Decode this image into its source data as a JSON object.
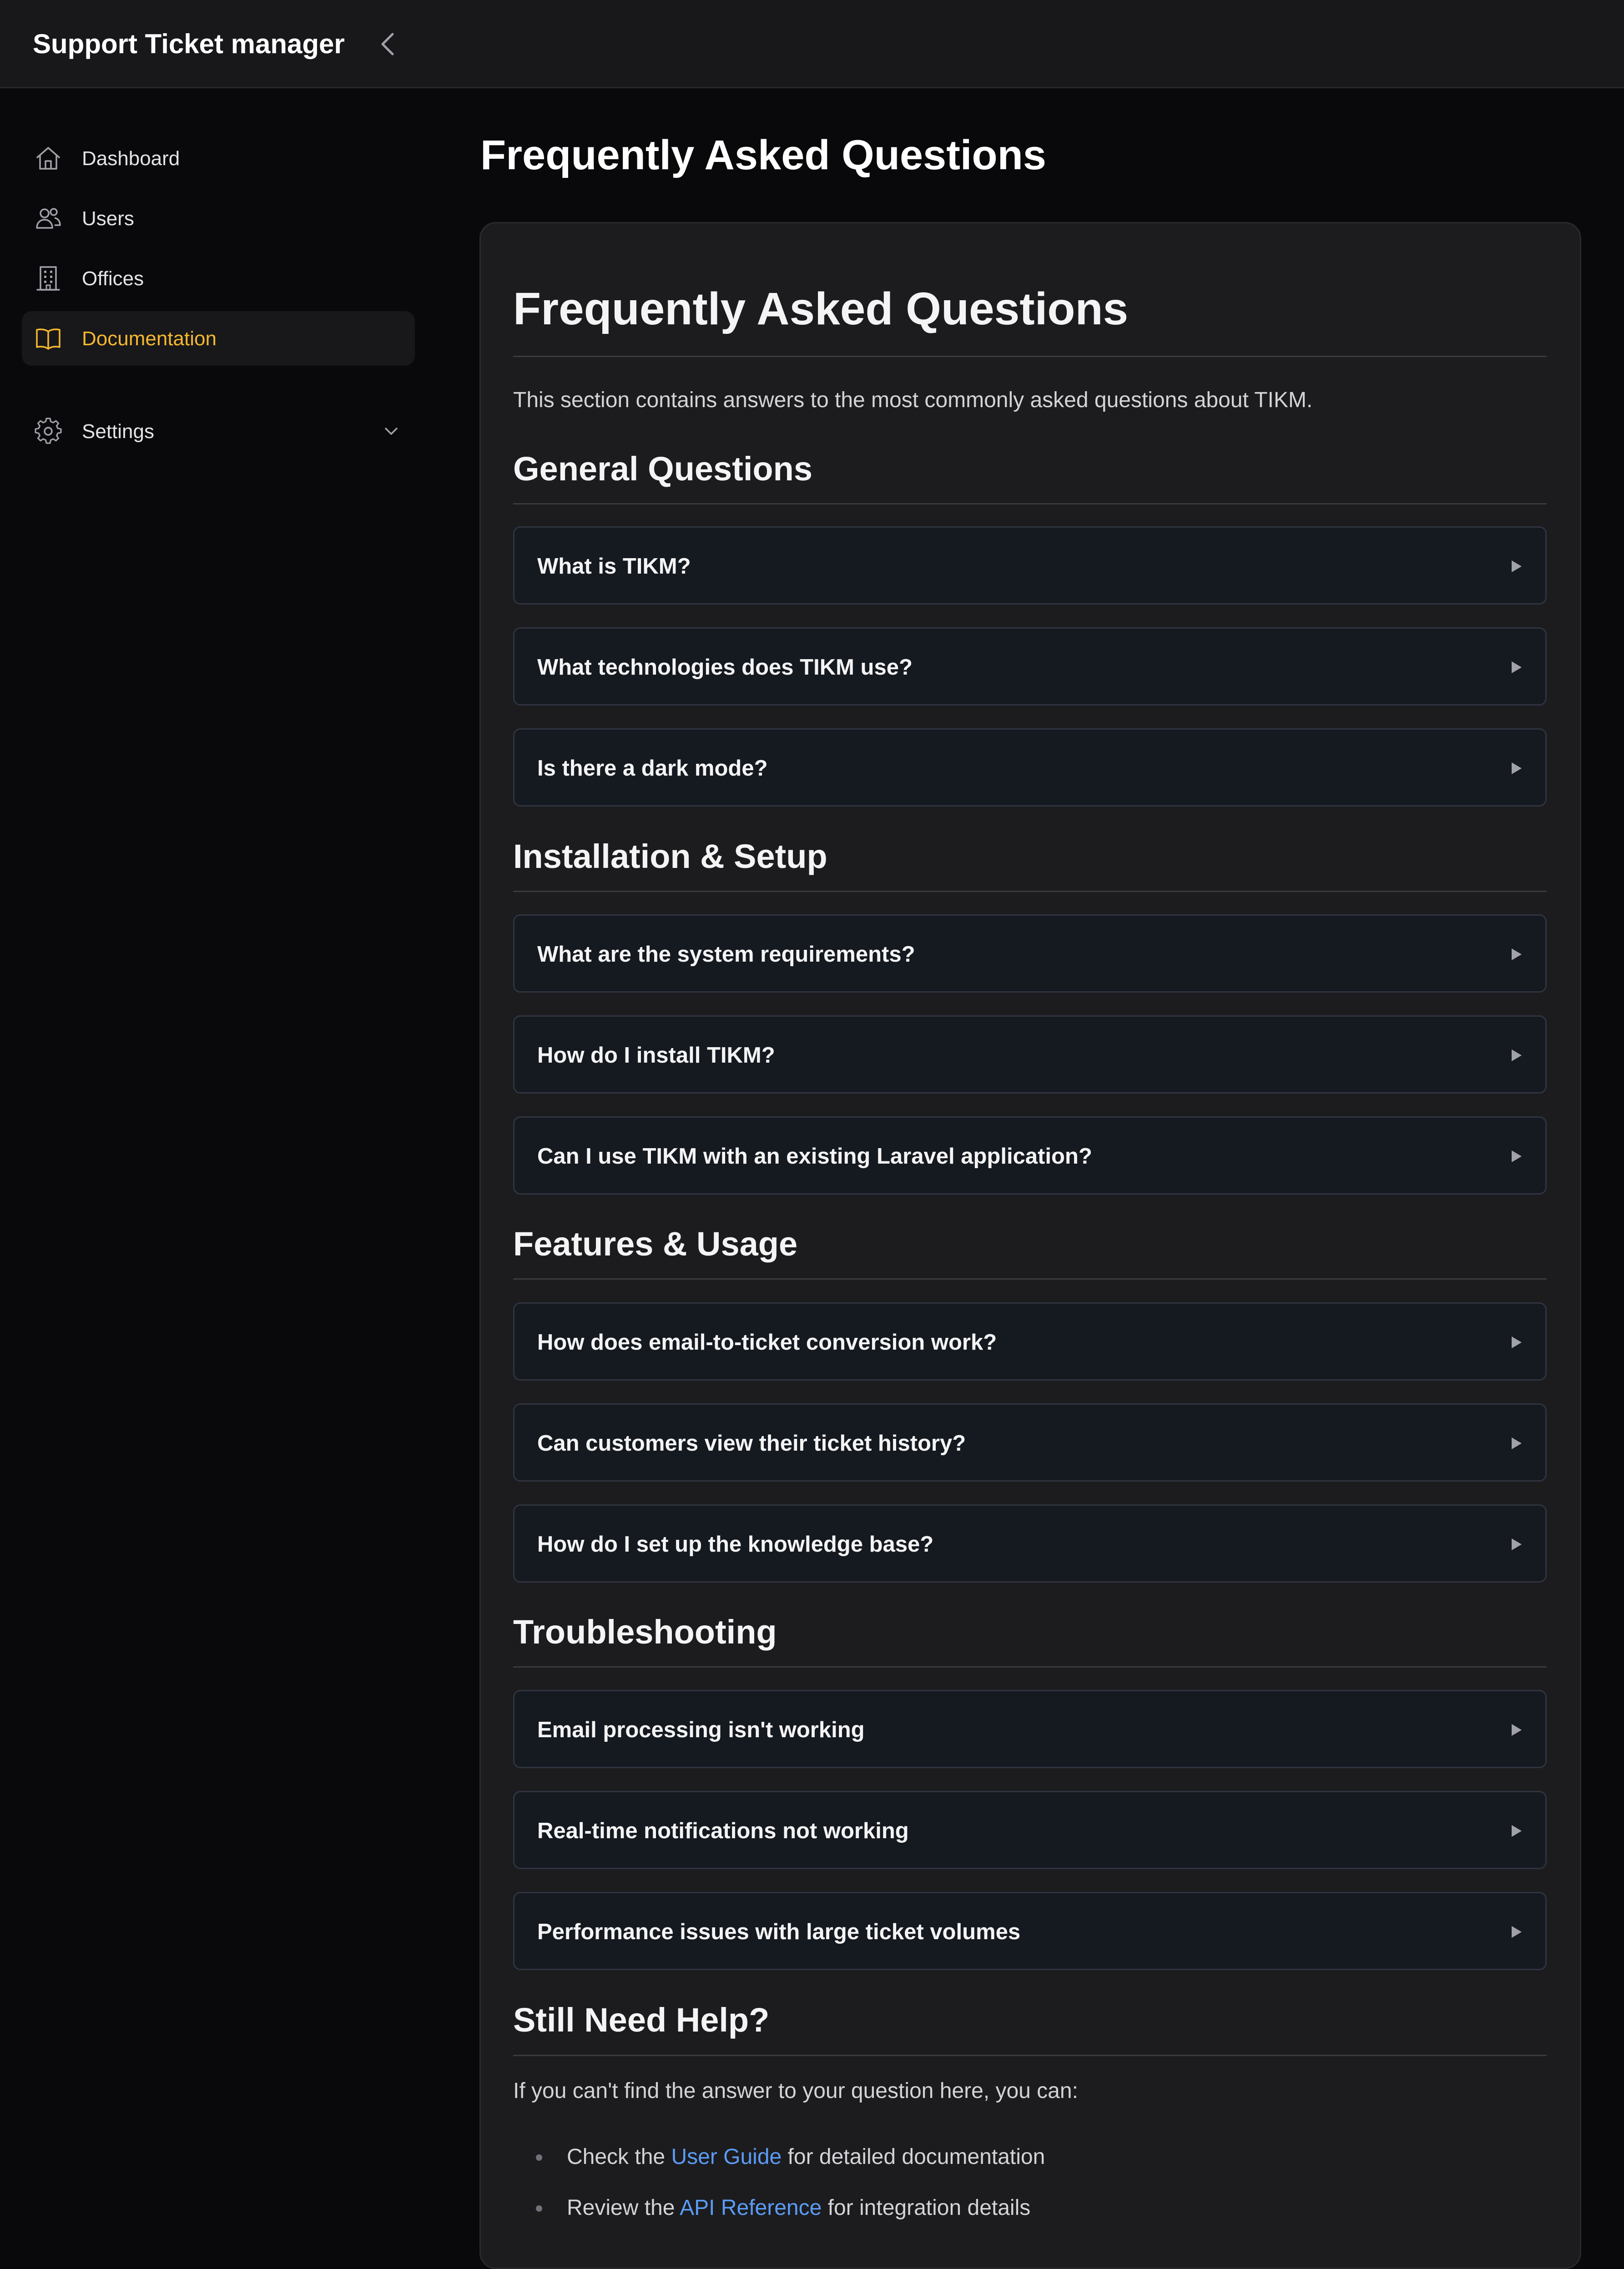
{
  "app": {
    "title": "Support Ticket manager"
  },
  "sidebar": {
    "items": [
      {
        "label": "Dashboard",
        "icon": "home-icon"
      },
      {
        "label": "Users",
        "icon": "users-icon"
      },
      {
        "label": "Offices",
        "icon": "building-icon"
      },
      {
        "label": "Documentation",
        "icon": "book-open-icon",
        "active": true
      },
      {
        "label": "Settings",
        "icon": "gear-icon",
        "expandable": true
      }
    ]
  },
  "page": {
    "title": "Frequently Asked Questions"
  },
  "content": {
    "heading": "Frequently Asked Questions",
    "intro": "This section contains answers to the most commonly asked questions about TIKM.",
    "sections": [
      {
        "title": "General Questions",
        "questions": [
          "What is TIKM?",
          "What technologies does TIKM use?",
          "Is there a dark mode?"
        ]
      },
      {
        "title": "Installation & Setup",
        "questions": [
          "What are the system requirements?",
          "How do I install TIKM?",
          "Can I use TIKM with an existing Laravel application?"
        ]
      },
      {
        "title": "Features & Usage",
        "questions": [
          "How does email-to-ticket conversion work?",
          "Can customers view their ticket history?",
          "How do I set up the knowledge base?"
        ]
      },
      {
        "title": "Troubleshooting",
        "questions": [
          "Email processing isn't working",
          "Real-time notifications not working",
          "Performance issues with large ticket volumes"
        ]
      }
    ],
    "help": {
      "title": "Still Need Help?",
      "text": "If you can't find the answer to your question here, you can:",
      "items": [
        {
          "prefix": "Check the ",
          "link": "User Guide",
          "suffix": " for detailed documentation"
        },
        {
          "prefix": "Review the ",
          "link": "API Reference",
          "suffix": " for integration details"
        }
      ]
    }
  },
  "colors": {
    "accent": "#f5b82e",
    "link": "#5b9cf5",
    "background": "#09090b",
    "card": "#1c1c1f"
  }
}
